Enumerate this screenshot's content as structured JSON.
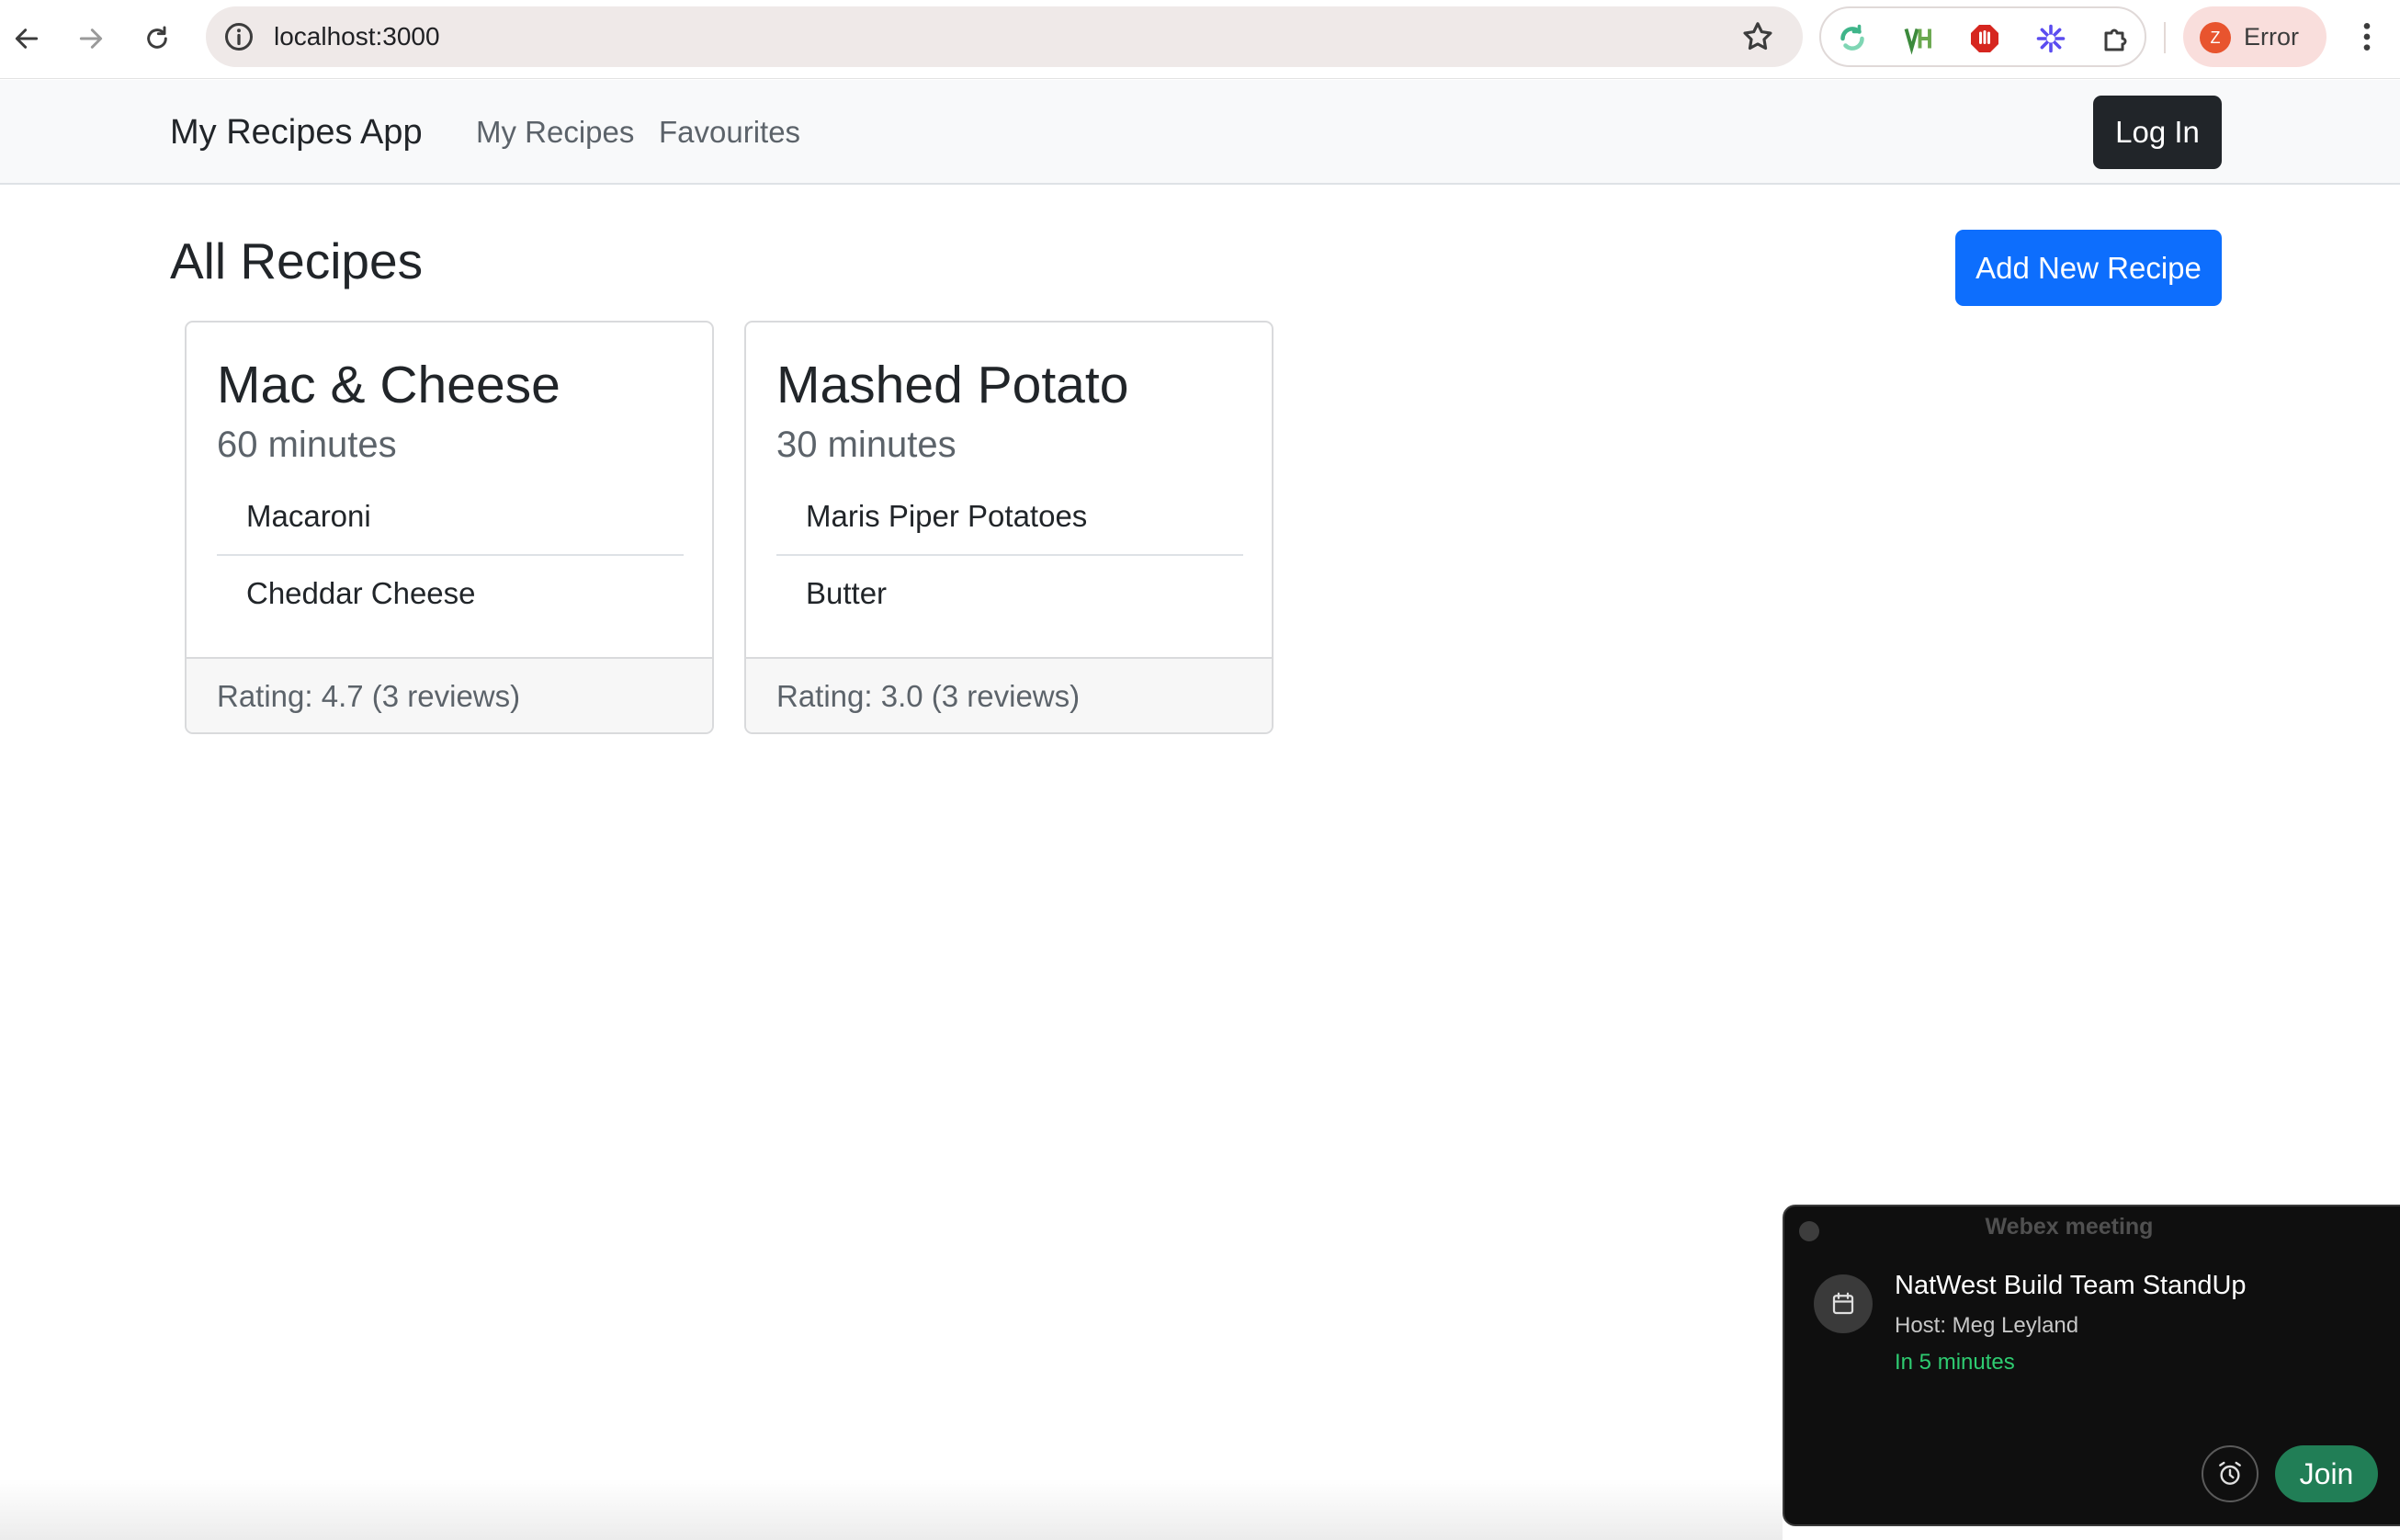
{
  "browser": {
    "url": "localhost:3000",
    "profile": {
      "initial": "Z",
      "label": "Error",
      "avatar_color": "#e8542e"
    },
    "extensions": [
      "sync-icon",
      "vh-extension-icon",
      "stop-hand-icon",
      "sparkle-icon",
      "puzzle-icon"
    ]
  },
  "navbar": {
    "brand": "My Recipes App",
    "links": [
      "My Recipes",
      "Favourites"
    ],
    "login_label": "Log In"
  },
  "main": {
    "title": "All Recipes",
    "add_button_label": "Add New Recipe",
    "recipes": [
      {
        "name": "Mac & Cheese",
        "time": "60 minutes",
        "ingredients": [
          "Macaroni",
          "Cheddar Cheese"
        ],
        "rating_text": "Rating: 4.7 (3 reviews)"
      },
      {
        "name": "Mashed Potato",
        "time": "30 minutes",
        "ingredients": [
          "Maris Piper Potatoes",
          "Butter"
        ],
        "rating_text": "Rating: 3.0 (3 reviews)"
      }
    ]
  },
  "webex": {
    "header": "Webex meeting",
    "meeting_title": "NatWest Build Team StandUp",
    "host": "Host: Meg Leyland",
    "starts": "In 5 minutes",
    "join_label": "Join"
  },
  "colors": {
    "primary": "#0d6efd",
    "dark": "#212529",
    "join_green": "#217e56",
    "time_green": "#2ecc71"
  }
}
